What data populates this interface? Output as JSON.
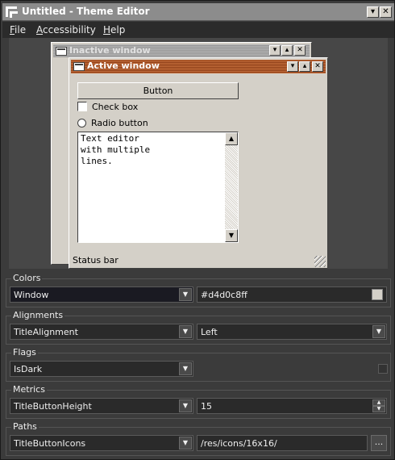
{
  "window": {
    "title": "Untitled - Theme Editor"
  },
  "menu": [
    {
      "label": "File",
      "underline_index": 0
    },
    {
      "label": "Accessibility",
      "underline_index": 0
    },
    {
      "label": "Help",
      "underline_index": 0
    }
  ],
  "preview": {
    "inactive_title": "Inactive window",
    "active_title": "Active window",
    "button_label": "Button",
    "checkbox_label": "Check box",
    "radio_label": "Radio button",
    "text_editor_content": "Text editor\nwith multiple\nlines.",
    "status_bar": "Status bar",
    "colors": {
      "active_title": "#b45a2c",
      "window": "#d4d0c8"
    }
  },
  "sections": {
    "colors": {
      "title": "Colors",
      "role": "Window",
      "value": "#d4d0c8ff",
      "swatch_color": "#d4d0c8"
    },
    "alignments": {
      "title": "Alignments",
      "role": "TitleAlignment",
      "value": "Left"
    },
    "flags": {
      "title": "Flags",
      "role": "IsDark",
      "checked": false
    },
    "metrics": {
      "title": "Metrics",
      "role": "TitleButtonHeight",
      "value": "15"
    },
    "paths": {
      "title": "Paths",
      "role": "TitleButtonIcons",
      "value": "/res/icons/16x16/",
      "browse_label": "..."
    }
  }
}
